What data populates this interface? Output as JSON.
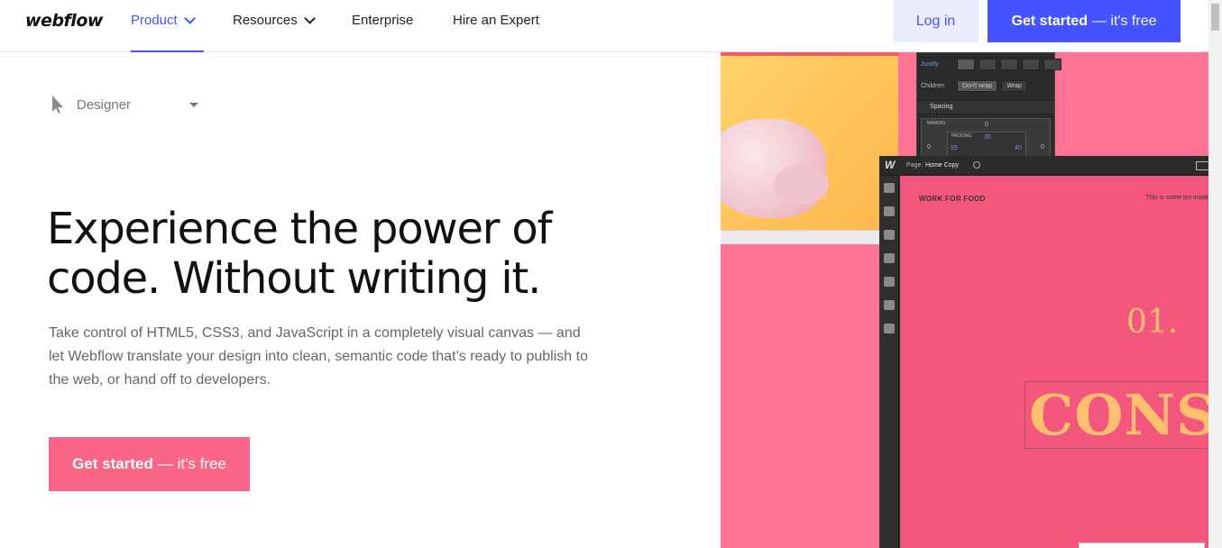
{
  "nav": {
    "logo": "webflow",
    "items": [
      {
        "label": "Product",
        "active": true,
        "dropdown": true
      },
      {
        "label": "Resources",
        "active": false,
        "dropdown": true
      },
      {
        "label": "Enterprise",
        "active": false,
        "dropdown": false
      },
      {
        "label": "Hire an Expert",
        "active": false,
        "dropdown": false
      }
    ],
    "login": "Log in",
    "get_started_bold": "Get started",
    "get_started_light": "— it's free"
  },
  "hero": {
    "selector_label": "Designer",
    "title": "Experience the power of code. Without writing it.",
    "subtitle": "Take control of HTML5, CSS3, and JavaScript in a completely visual canvas — and let Webflow translate your design into clean, semantic code that’s ready to publish to the web, or hand off to developers.",
    "cta_bold": "Get started",
    "cta_light": "— it's free"
  },
  "visual": {
    "panel": {
      "justify_label": "Justify",
      "children_label": "Children",
      "dont_wrap": "Don't wrap",
      "wrap": "Wrap",
      "spacing_label": "Spacing",
      "margin_label": "MARGIN",
      "margin_value": "0",
      "padding_label": "PADDING",
      "padding_top": "35",
      "padding_left": "55",
      "padding_right": "40",
      "outer_left": "0",
      "outer_right": "0"
    },
    "editor": {
      "logo": "W",
      "page_label": "Page:",
      "page_name": "Home Copy",
      "work_label": "WORK FOR FOOD",
      "note_text": "This is some tex inside of a div block",
      "number": "01.",
      "big_text": "CONS"
    }
  },
  "colors": {
    "accent": "#4353ff",
    "cta": "#fa6585",
    "visual_bg": "#ff7394",
    "canvas_bg": "#f4577d"
  }
}
